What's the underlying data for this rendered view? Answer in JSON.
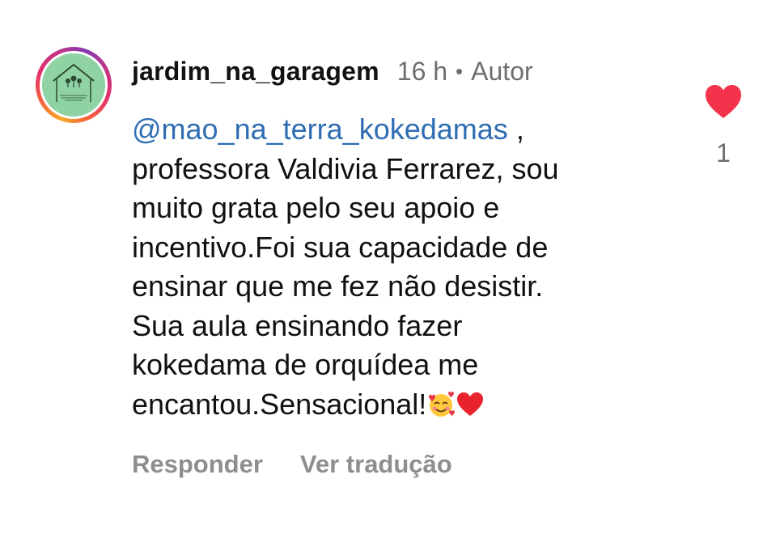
{
  "comment": {
    "username": "jardim_na_garagem",
    "time": "16 h",
    "separator": "•",
    "author_badge": "Autor",
    "avatar": {
      "icon": "garden-logo-avatar",
      "logo_text": "Jardim na Garagem"
    },
    "mention": "@mao_na_terra_kokedamas",
    "body_lines": [
      " ,",
      "professora Valdivia Ferrarez, sou",
      "muito grata pelo seu apoio e",
      "incentivo.Foi sua capacidade de",
      "ensinar que me fez não desistir.",
      "Sua aula ensinando fazer",
      "kokedama de orquídea me",
      "encantou.Sensacional!"
    ],
    "emojis": [
      "smiling-face-with-hearts-emoji",
      "red-heart-emoji"
    ]
  },
  "actions": {
    "reply_label": "Responder",
    "translate_label": "Ver tradução"
  },
  "like": {
    "icon": "heart-icon",
    "count": "1",
    "color": "#f2334b"
  },
  "colors": {
    "mention": "#2f6db3",
    "meta": "#6e6e6e",
    "actions": "#8e8e8e",
    "avatar_bg": "#8fd3a4"
  }
}
